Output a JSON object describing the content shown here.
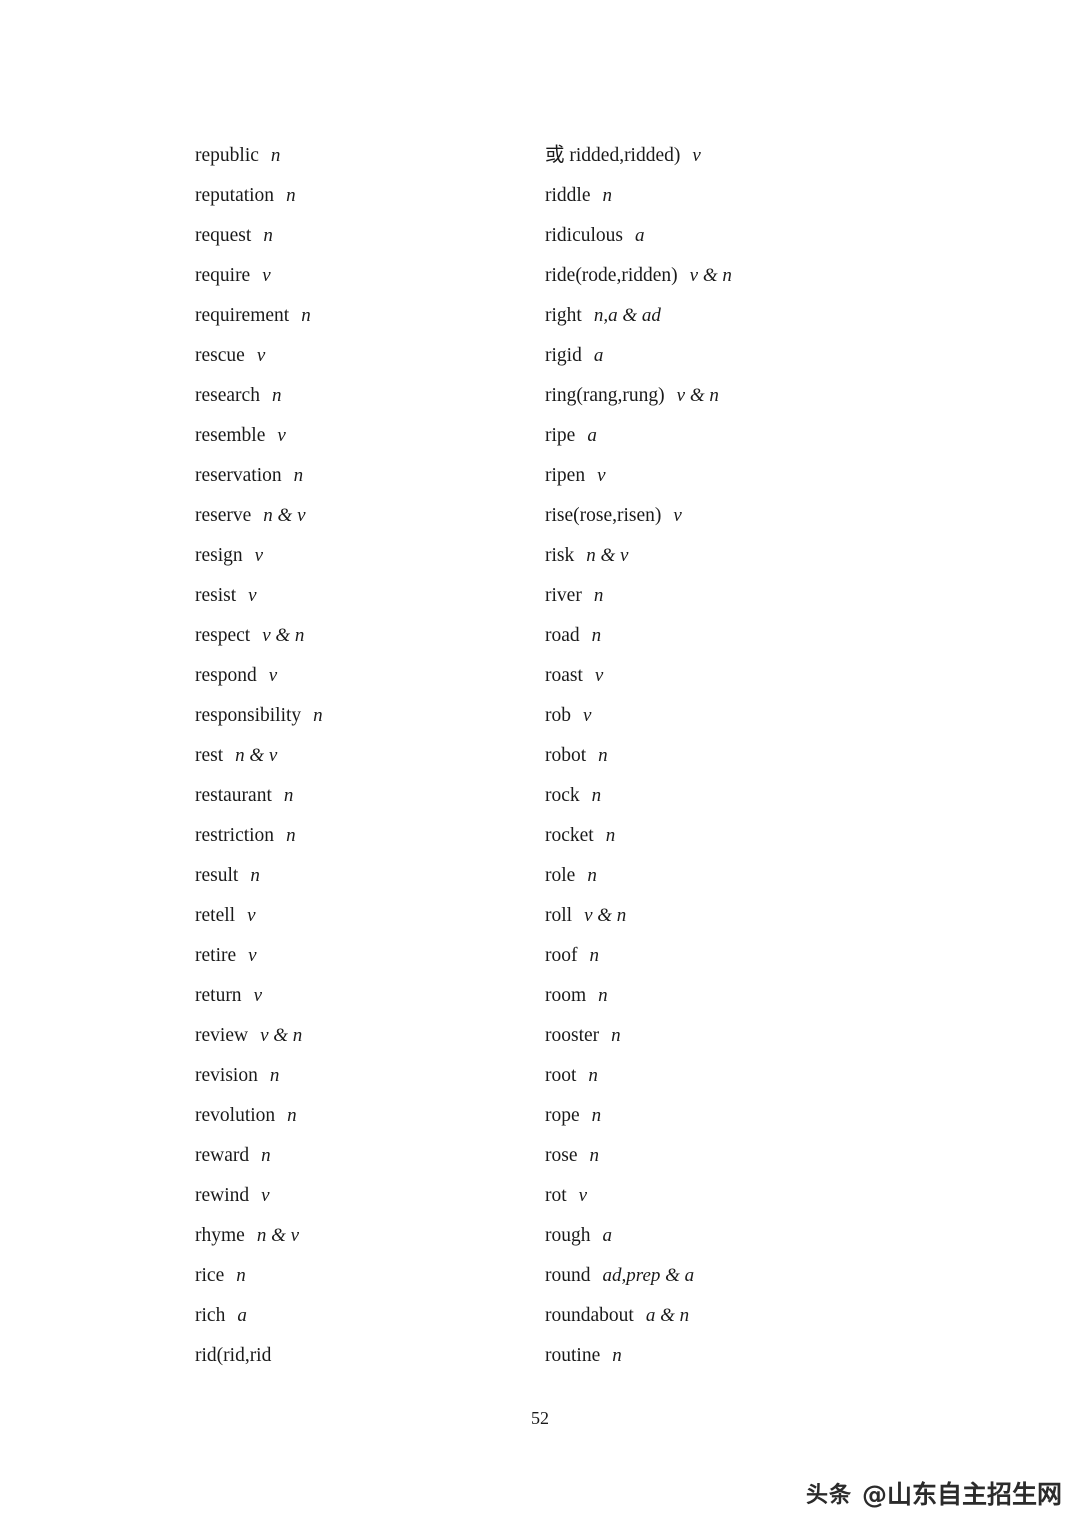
{
  "document": {
    "page_number": "52",
    "columns": [
      {
        "entries": [
          {
            "word": "republic",
            "pos": "n"
          },
          {
            "word": "reputation",
            "pos": "n"
          },
          {
            "word": "request",
            "pos": "n"
          },
          {
            "word": "require",
            "pos": "v"
          },
          {
            "word": "requirement",
            "pos": "n"
          },
          {
            "word": "rescue",
            "pos": "v"
          },
          {
            "word": "research",
            "pos": "n"
          },
          {
            "word": "resemble",
            "pos": "v"
          },
          {
            "word": "reservation",
            "pos": "n"
          },
          {
            "word": "reserve",
            "pos": "n & v"
          },
          {
            "word": "resign",
            "pos": "v"
          },
          {
            "word": "resist",
            "pos": "v"
          },
          {
            "word": "respect",
            "pos": "v & n"
          },
          {
            "word": "respond",
            "pos": "v"
          },
          {
            "word": "responsibility",
            "pos": "n"
          },
          {
            "word": "rest",
            "pos": "n & v"
          },
          {
            "word": "restaurant",
            "pos": "n"
          },
          {
            "word": "restriction",
            "pos": "n"
          },
          {
            "word": "result",
            "pos": "n"
          },
          {
            "word": "retell",
            "pos": "v"
          },
          {
            "word": "retire",
            "pos": "v"
          },
          {
            "word": "return",
            "pos": "v"
          },
          {
            "word": "review",
            "pos": "v & n"
          },
          {
            "word": "revision",
            "pos": "n"
          },
          {
            "word": "revolution",
            "pos": "n"
          },
          {
            "word": "reward",
            "pos": "n"
          },
          {
            "word": "rewind",
            "pos": "v"
          },
          {
            "word": "rhyme",
            "pos": "n & v"
          },
          {
            "word": "rice",
            "pos": "n"
          },
          {
            "word": "rich",
            "pos": "a"
          },
          {
            "word": "rid(rid,rid",
            "pos": ""
          }
        ]
      },
      {
        "entries": [
          {
            "word": "或 ridded,ridded)",
            "pos": "v"
          },
          {
            "word": "riddle",
            "pos": "n"
          },
          {
            "word": "ridiculous",
            "pos": "a"
          },
          {
            "word": "ride(rode,ridden)",
            "pos": "v & n"
          },
          {
            "word": "right",
            "pos": "n,a & ad"
          },
          {
            "word": "rigid",
            "pos": "a"
          },
          {
            "word": "ring(rang,rung)",
            "pos": "v & n"
          },
          {
            "word": "ripe",
            "pos": "a"
          },
          {
            "word": "ripen",
            "pos": "v"
          },
          {
            "word": "rise(rose,risen)",
            "pos": "v"
          },
          {
            "word": "risk",
            "pos": "n & v"
          },
          {
            "word": "river",
            "pos": "n"
          },
          {
            "word": "road",
            "pos": "n"
          },
          {
            "word": "roast",
            "pos": "v"
          },
          {
            "word": "rob",
            "pos": "v"
          },
          {
            "word": "robot",
            "pos": "n"
          },
          {
            "word": "rock",
            "pos": "n"
          },
          {
            "word": "rocket",
            "pos": "n"
          },
          {
            "word": "role",
            "pos": "n"
          },
          {
            "word": "roll",
            "pos": "v & n"
          },
          {
            "word": "roof",
            "pos": "n"
          },
          {
            "word": "room",
            "pos": "n"
          },
          {
            "word": "rooster",
            "pos": "n"
          },
          {
            "word": "root",
            "pos": "n"
          },
          {
            "word": "rope",
            "pos": "n"
          },
          {
            "word": "rose",
            "pos": "n"
          },
          {
            "word": "rot",
            "pos": "v"
          },
          {
            "word": "rough",
            "pos": "a"
          },
          {
            "word": "round",
            "pos": "ad,prep & a"
          },
          {
            "word": "roundabout",
            "pos": "a & n"
          },
          {
            "word": "routine",
            "pos": "n"
          }
        ]
      }
    ]
  },
  "watermark": {
    "logo": "头条",
    "text": "@山东自主招生网"
  }
}
